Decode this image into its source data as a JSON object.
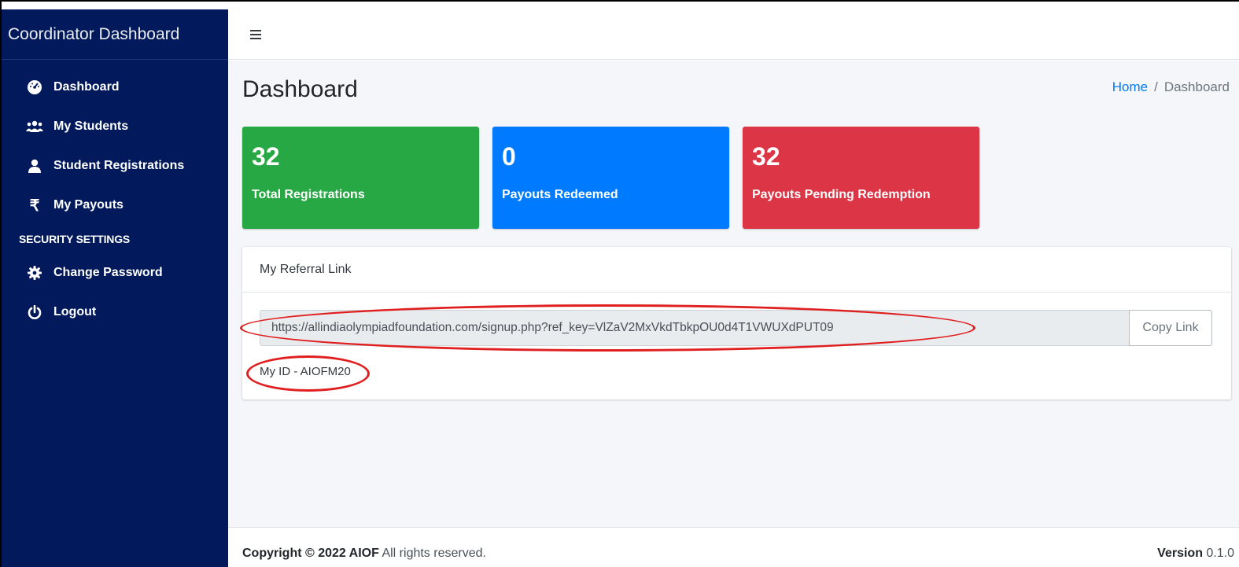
{
  "sidebar": {
    "brand": "Coordinator Dashboard",
    "items": [
      {
        "label": "Dashboard",
        "icon": "tachometer-icon"
      },
      {
        "label": "My Students",
        "icon": "users-icon"
      },
      {
        "label": "Student Registrations",
        "icon": "user-icon"
      },
      {
        "label": "My Payouts",
        "icon": "rupee-icon"
      }
    ],
    "section_header": "SECURITY SETTINGS",
    "security_items": [
      {
        "label": "Change Password",
        "icon": "gear-icon"
      },
      {
        "label": "Logout",
        "icon": "power-icon"
      }
    ]
  },
  "header": {
    "menu_icon": "hamburger-icon"
  },
  "main": {
    "title": "Dashboard",
    "breadcrumb": {
      "home": "Home",
      "separator": "/",
      "current": "Dashboard"
    },
    "stats": [
      {
        "value": "32",
        "label": "Total Registrations",
        "color": "#28a745"
      },
      {
        "value": "0",
        "label": "Payouts Redeemed",
        "color": "#007bff"
      },
      {
        "value": "32",
        "label": "Payouts Pending Redemption",
        "color": "#dc3545"
      }
    ],
    "referral": {
      "title": "My Referral Link",
      "url": "https://allindiaolympiadfoundation.com/signup.php?ref_key=VlZaV2MxVkdTbkpOU0d4T1VWUXdPUT09",
      "copy_label": "Copy Link",
      "my_id": "My ID - AIOFM20"
    }
  },
  "footer": {
    "copyright_bold": "Copyright © 2022 AIOF",
    "copyright_rest": " All rights reserved.",
    "version_label": "Version",
    "version_value": " 0.1.0"
  },
  "colors": {
    "sidebar": "#021a5b",
    "annotation": "#e02020",
    "link": "#007bff"
  }
}
